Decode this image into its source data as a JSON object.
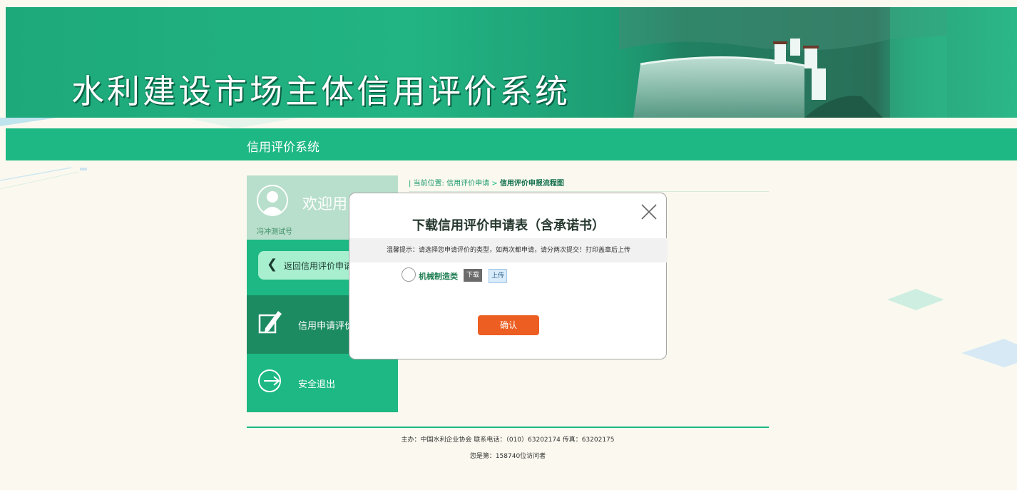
{
  "banner": {
    "title": "水利建设市场主体信用评价系统"
  },
  "navbar": {
    "title": "信用评价系统"
  },
  "sidebar": {
    "welcome": "欢迎用",
    "username": "冯冲测试号",
    "back_label": "返回信用评价申请",
    "items": [
      {
        "label": "信用申请评价",
        "icon": "edit-icon",
        "active": true
      },
      {
        "label": "安全退出",
        "icon": "logout-icon",
        "active": false
      }
    ]
  },
  "breadcrumb": {
    "prefix": "| 当前位置:",
    "level1": "信用评价申请",
    "separator": ">",
    "current": "信用评价申报流程图"
  },
  "modal": {
    "title": "下载信用评价申请表（含承诺书）",
    "tip": "温馨提示：请选择您申请评价的类型，如两次都申请，请分两次提交！打印盖章后上传",
    "options": [
      {
        "label": "机械制造类",
        "download_label": "下载",
        "upload_label": "上传",
        "selected": false
      }
    ],
    "confirm_label": "确认"
  },
  "footer": {
    "line1": "主办：中国水利企业协会 联系电话：（010）63202174 传真：63202175",
    "line2": "您是第：158740位访问者"
  },
  "colors": {
    "primary_green": "#1db883",
    "dark_green": "#1c8b62",
    "light_green": "#a8efcf",
    "confirm_orange": "#ec5e22",
    "page_bg": "#fbf9ef"
  }
}
